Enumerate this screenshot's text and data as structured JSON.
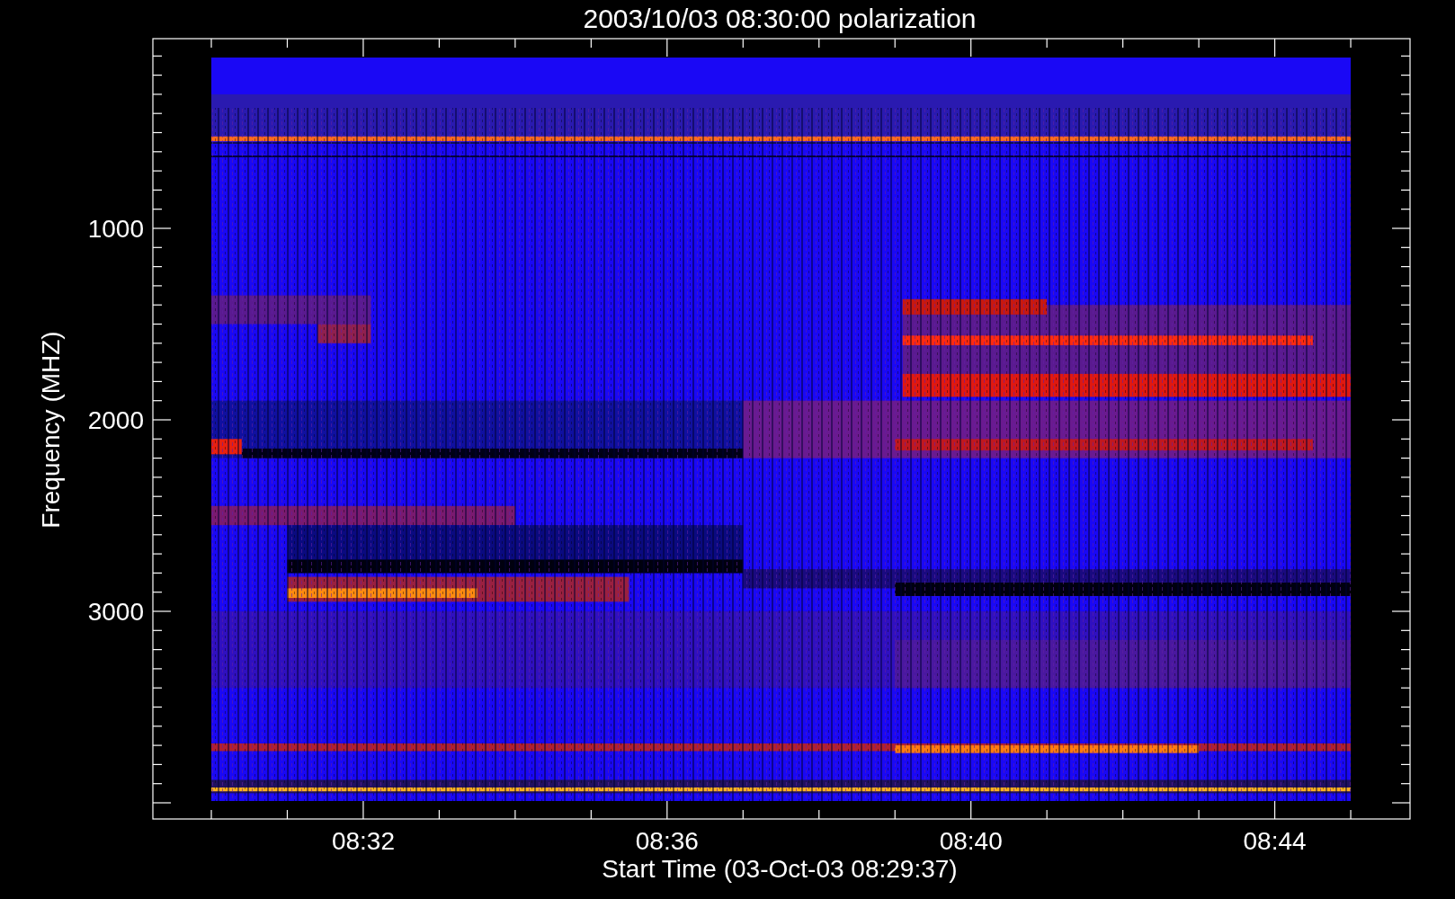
{
  "title": "2003/10/03 08:30:00 polarization",
  "ylabel": "Frequency (MHZ)",
  "xlabel": "Start Time (03-Oct-03 08:29:37)",
  "yticks": [
    "1000",
    "2000",
    "3000"
  ],
  "xticks": [
    "08:32",
    "08:36",
    "08:40",
    "08:44"
  ]
}
